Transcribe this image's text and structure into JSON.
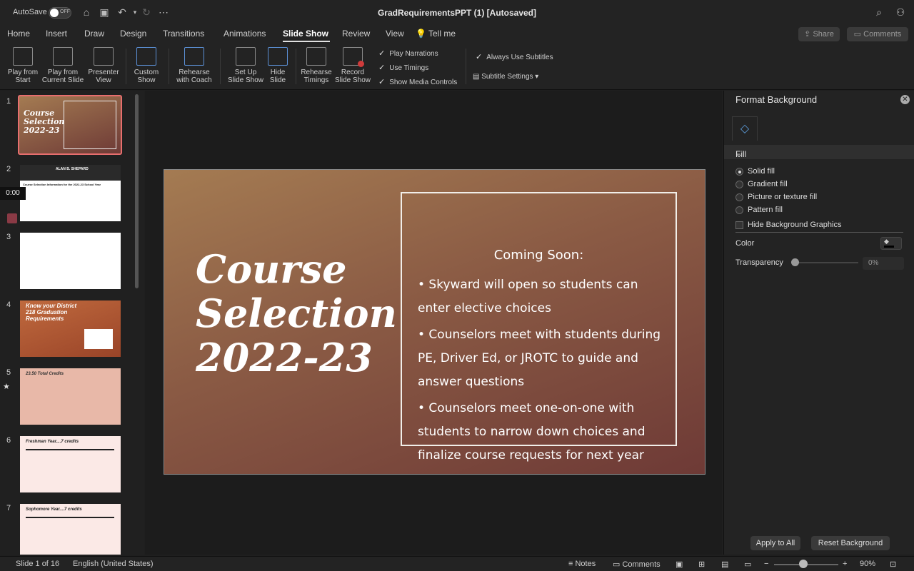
{
  "titlebar": {
    "autosave_label": "AutoSave",
    "autosave_state": "OFF",
    "doc_title": "GradRequirementsPPT (1) [Autosaved]"
  },
  "tabs": [
    "Home",
    "Insert",
    "Draw",
    "Design",
    "Transitions",
    "Animations",
    "Slide Show",
    "Review",
    "View",
    "Tell me"
  ],
  "header_buttons": {
    "share": "Share",
    "comments": "Comments"
  },
  "ribbon": {
    "play_from_start": "Play from\nStart",
    "play_current": "Play from\nCurrent Slide",
    "presenter_view": "Presenter\nView",
    "custom_show": "Custom\nShow",
    "rehearse_coach": "Rehearse\nwith Coach",
    "set_up": "Set Up\nSlide Show",
    "hide_slide": "Hide\nSlide",
    "rehearse_timings": "Rehearse\nTimings",
    "record": "Record\nSlide Show",
    "play_narrations": "Play Narrations",
    "use_timings": "Use Timings",
    "show_media": "Show Media Controls",
    "always_subtitles": "Always Use Subtitles",
    "subtitle_settings": "Subtitle Settings"
  },
  "thumbnails": {
    "numbers": [
      "1",
      "2",
      "3",
      "4",
      "5",
      "6",
      "7"
    ],
    "timer": "0:00",
    "t1_title": "Course Selection 2022-23",
    "t2_title": "ALAN B. SHEPARD",
    "t2_sub": "Course Selection Information for the 2022-23 School Year",
    "t4_title": "Know your District 218 Graduation Requirements",
    "t5_title": "23.50 Total Credits",
    "t6_title": "Freshman Year....7 credits",
    "t7_title": "Sophomore Year....7 credits"
  },
  "slide": {
    "title_line1": "Course",
    "title_line2": "Selection",
    "title_line3": "2022-23",
    "box_heading": "Coming Soon:",
    "bullet1": "• Skyward will open so students can enter elective choices",
    "bullet2": "• Counselors meet with students during PE, Driver Ed, or JROTC to guide and answer questions",
    "bullet3": "•  Counselors meet one-on-one with students to narrow down choices and  finalize course requests for next year"
  },
  "panel": {
    "title": "Format Background",
    "fill_header": "Fill",
    "solid": "Solid fill",
    "gradient": "Gradient fill",
    "picture": "Picture or texture fill",
    "pattern": "Pattern fill",
    "hide_bg": "Hide Background Graphics",
    "color_label": "Color",
    "transparency_label": "Transparency",
    "transparency_value": "0%",
    "apply_all": "Apply to All",
    "reset_bg": "Reset Background"
  },
  "status": {
    "slide_of": "Slide 1 of 16",
    "language": "English (United States)",
    "notes": "Notes",
    "comments": "Comments",
    "zoom": "90%"
  }
}
